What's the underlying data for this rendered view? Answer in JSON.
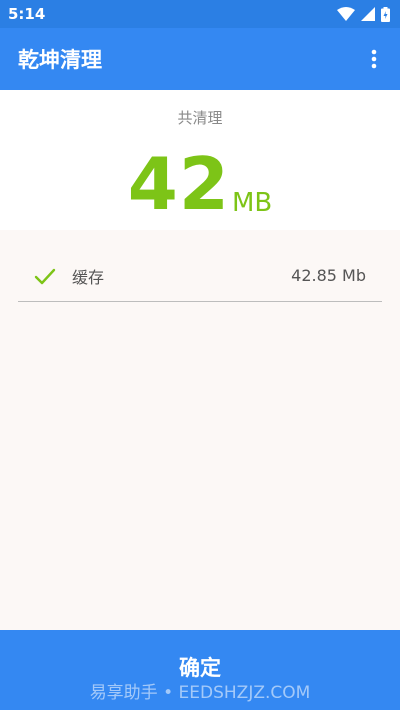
{
  "status_bar": {
    "time": "5:14",
    "icons": [
      "wifi-icon",
      "signal-icon",
      "battery-icon"
    ]
  },
  "app_bar": {
    "title": "乾坤清理",
    "menu_icon": "more-vert-icon"
  },
  "summary": {
    "label": "共清理",
    "amount": "42",
    "unit": "MB",
    "accent_color": "#7dc417"
  },
  "items": [
    {
      "icon": "check-icon",
      "name": "缓存",
      "size": "42.85 Mb"
    }
  ],
  "confirm_button": {
    "label": "确定"
  },
  "watermark": "易享助手 • EEDSHZJZ.COM",
  "colors": {
    "primary": "#3488f2",
    "status_bar": "#2b7fe4",
    "list_background": "#fcf8f6"
  }
}
